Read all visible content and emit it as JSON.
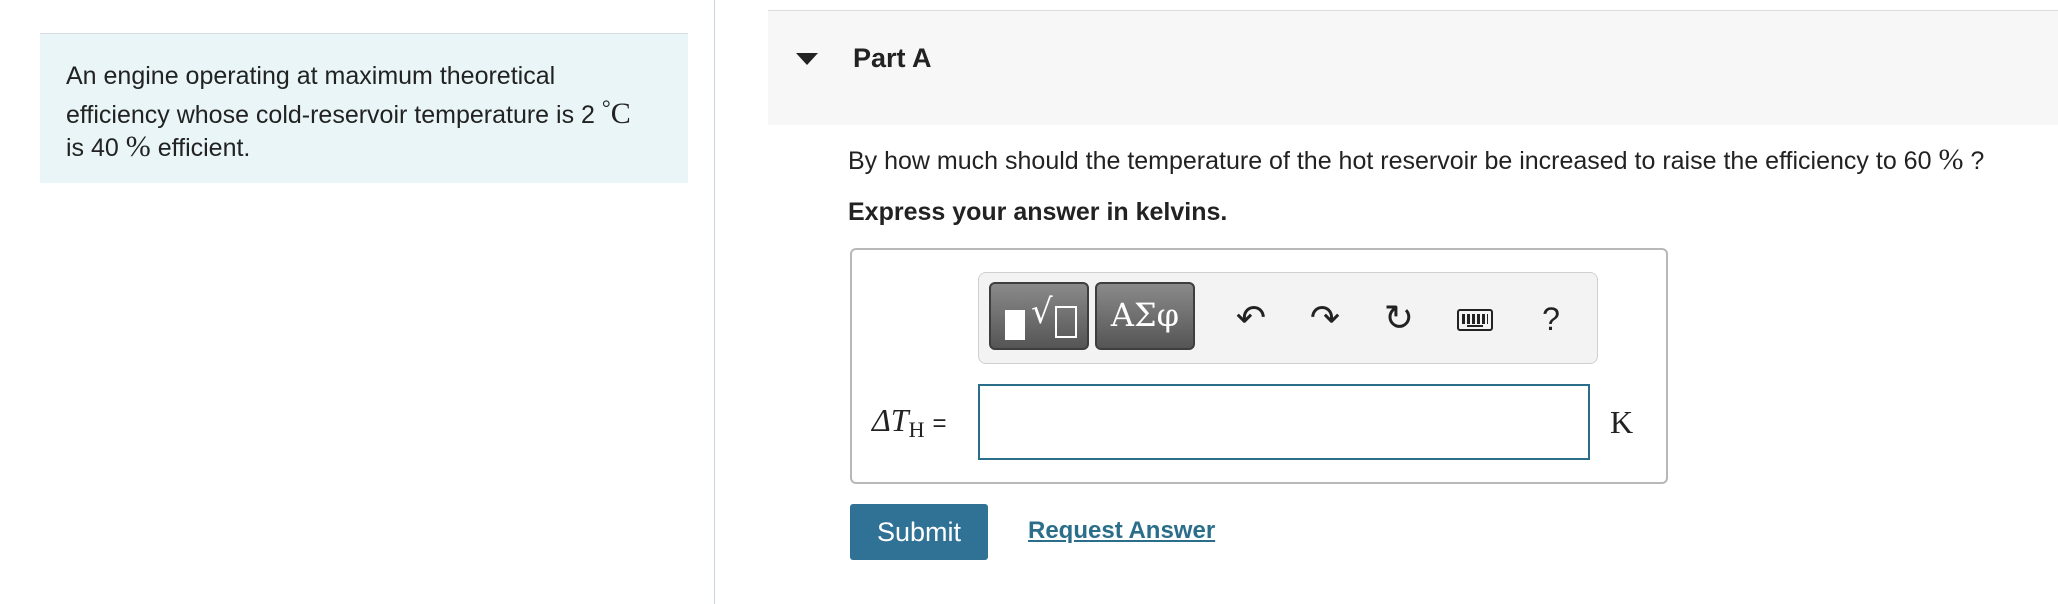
{
  "problem": {
    "line1": "An engine operating at maximum theoretical",
    "line2_text": "efficiency whose cold-reservoir temperature is 2",
    "line2_unit_deg": "°",
    "line2_unit_c": "C",
    "line3_prefix": "is 40",
    "line3_percent": "%",
    "line3_suffix": "efficient."
  },
  "part": {
    "title": "Part A",
    "question_text": "By how much should the temperature of the hot reservoir be increased to raise the efficiency to 60",
    "question_percent": "%",
    "question_end": "?",
    "instruction": "Express your answer in kelvins."
  },
  "toolbar": {
    "templates_icon": "templates-icon",
    "sqrt_glyph": "√",
    "symbols_label": "ΑΣφ",
    "undo_glyph": "↶",
    "redo_glyph": "↷",
    "reset_glyph": "↻",
    "keyboard_icon": "keyboard-icon",
    "help_label": "?"
  },
  "answer": {
    "label_delta_t": "ΔT",
    "label_subscript": "H",
    "label_equals": "=",
    "value": "",
    "unit": "K"
  },
  "actions": {
    "submit_label": "Submit",
    "request_label": "Request Answer"
  },
  "colors": {
    "accent": "#2f7295",
    "intro_bg": "#e9f5f7",
    "input_border": "#2b6e8a"
  }
}
